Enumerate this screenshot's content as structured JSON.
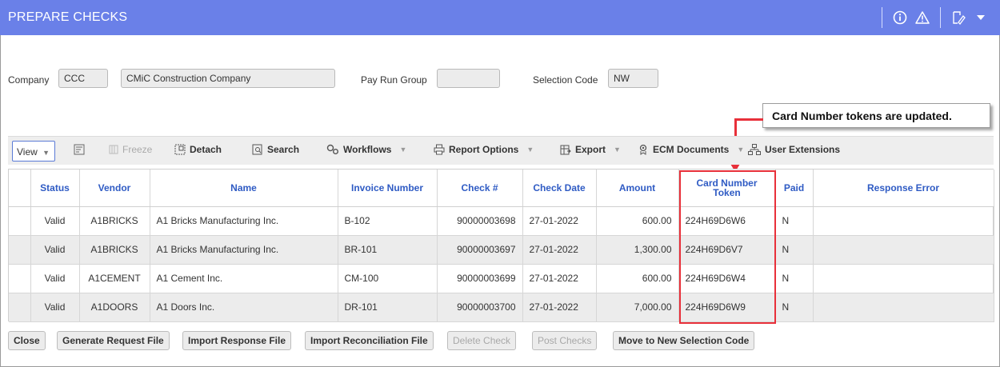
{
  "header": {
    "title": "PREPARE CHECKS",
    "icons": [
      "info-icon",
      "warning-icon",
      "edit-icon",
      "chevron-down-icon"
    ],
    "accent_color": "#6a80e8"
  },
  "form": {
    "company_label": "Company",
    "company_code": "CCC",
    "company_name": "CMiC Construction Company",
    "pay_run_group_label": "Pay Run Group",
    "pay_run_group_value": "",
    "selection_code_label": "Selection Code",
    "selection_code_value": "NW"
  },
  "callout": {
    "text": "Card Number tokens are updated.",
    "color": "#e8303a"
  },
  "toolbar": {
    "view_label": "View",
    "freeze_label": "Freeze",
    "detach_label": "Detach",
    "search_label": "Search",
    "workflows_label": "Workflows",
    "report_options_label": "Report Options",
    "export_label": "Export",
    "ecm_documents_label": "ECM Documents",
    "user_extensions_label": "User Extensions"
  },
  "table": {
    "columns": [
      "Status",
      "Vendor",
      "Name",
      "Invoice Number",
      "Check #",
      "Check Date",
      "Amount",
      "Card Number Token",
      "Paid",
      "Response Error"
    ],
    "rows": [
      {
        "status": "Valid",
        "vendor": "A1BRICKS",
        "name": "A1 Bricks Manufacturing Inc.",
        "invoice": "B-102",
        "check": "90000003698",
        "date": "27-01-2022",
        "amount": "600.00",
        "token": "224H69D6W6",
        "paid": "N",
        "error": ""
      },
      {
        "status": "Valid",
        "vendor": "A1BRICKS",
        "name": "A1 Bricks Manufacturing Inc.",
        "invoice": "BR-101",
        "check": "90000003697",
        "date": "27-01-2022",
        "amount": "1,300.00",
        "token": "224H69D6V7",
        "paid": "N",
        "error": ""
      },
      {
        "status": "Valid",
        "vendor": "A1CEMENT",
        "name": "A1 Cement Inc.",
        "invoice": "CM-100",
        "check": "90000003699",
        "date": "27-01-2022",
        "amount": "600.00",
        "token": "224H69D6W4",
        "paid": "N",
        "error": ""
      },
      {
        "status": "Valid",
        "vendor": "A1DOORS",
        "name": "A1 Doors Inc.",
        "invoice": "DR-101",
        "check": "90000003700",
        "date": "27-01-2022",
        "amount": "7,000.00",
        "token": "224H69D6W9",
        "paid": "N",
        "error": ""
      }
    ]
  },
  "buttons": {
    "close": "Close",
    "generate_request": "Generate Request File",
    "import_response": "Import Response File",
    "import_reconciliation": "Import Reconciliation File",
    "delete_check": "Delete Check",
    "post_checks": "Post Checks",
    "move_selection": "Move to New Selection Code"
  }
}
